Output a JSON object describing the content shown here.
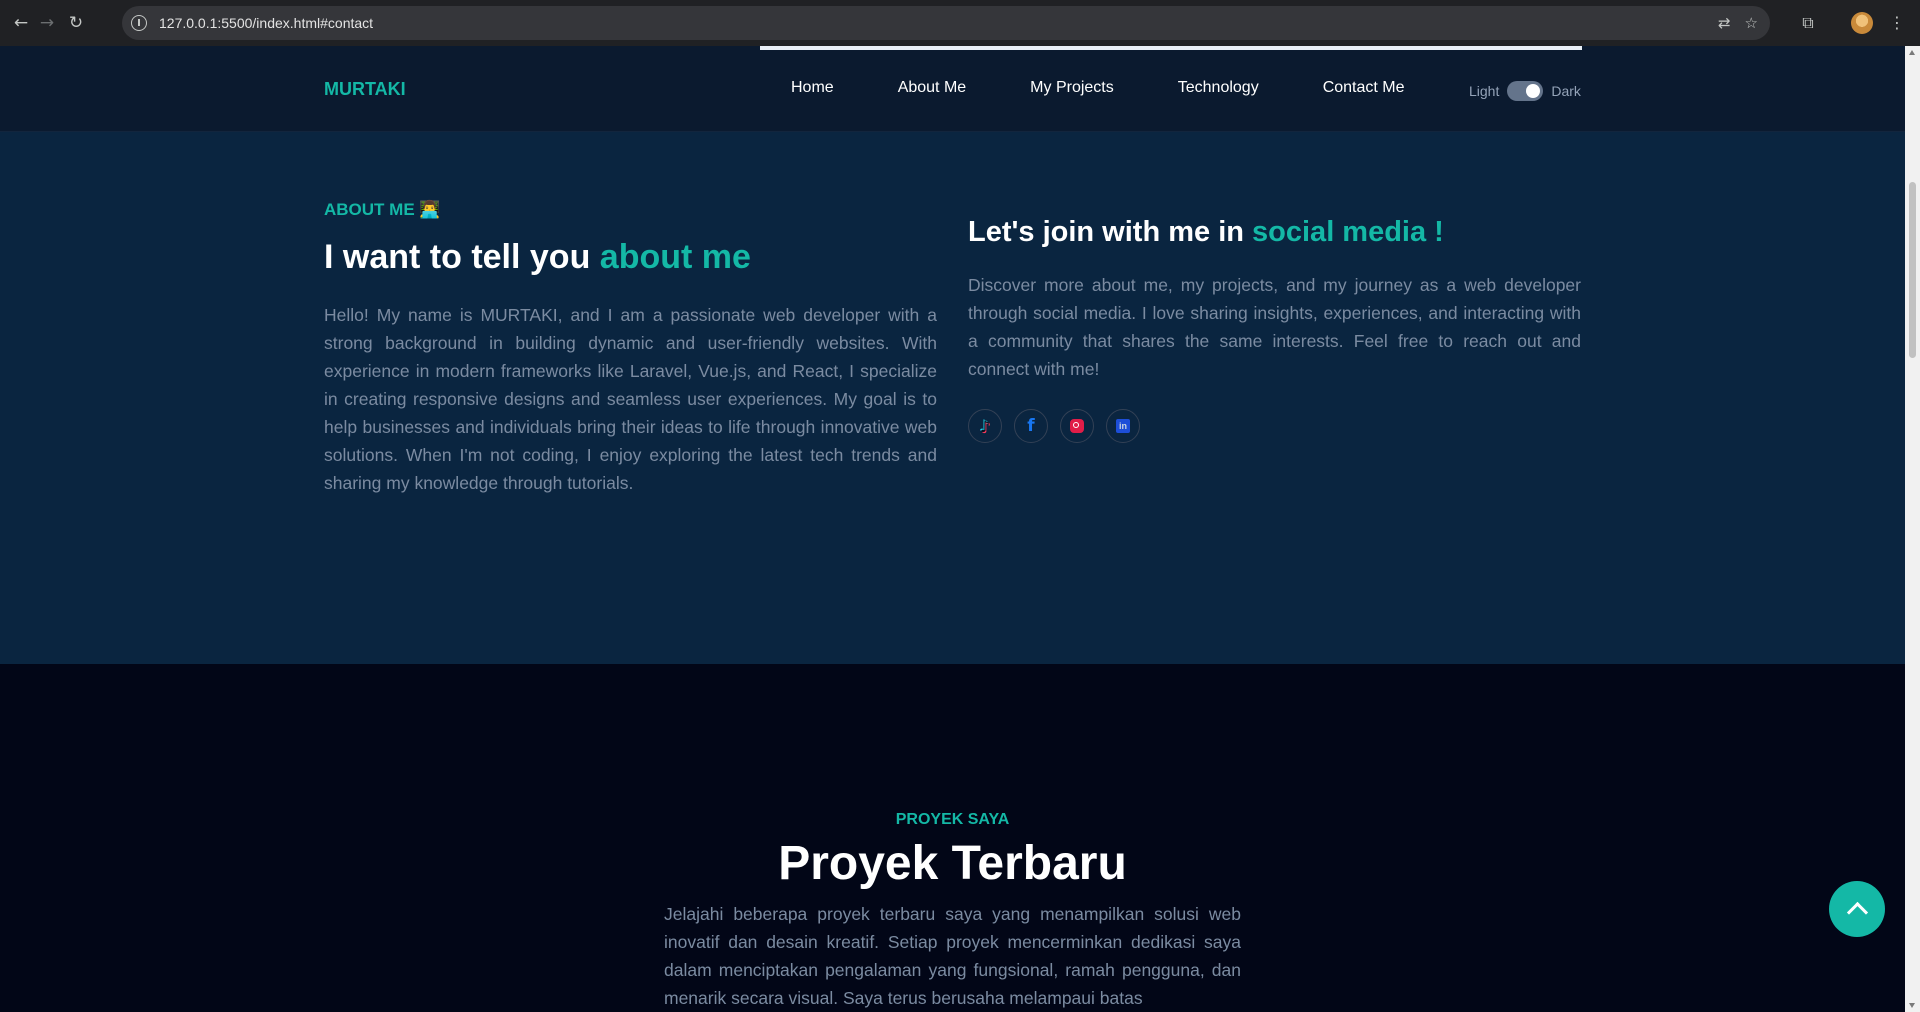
{
  "browser": {
    "url": "127.0.0.1:5500/index.html#contact",
    "icons": [
      "back-icon",
      "forward-icon",
      "reload-icon",
      "info-icon",
      "translate-icon",
      "star-icon",
      "extensions-icon",
      "profile-avatar",
      "menu-icon"
    ]
  },
  "header": {
    "logo": "MURTAKI",
    "nav": [
      "Home",
      "About Me",
      "My Projects",
      "Technology",
      "Contact Me"
    ],
    "toggle": {
      "light": "Light",
      "dark": "Dark",
      "state": "dark"
    }
  },
  "about": {
    "eyebrow": "ABOUT ME 👨‍💻",
    "heading_plain": "I want to tell you ",
    "heading_accent": "about me",
    "paragraph": "Hello! My name is MURTAKI, and I am a passionate web developer with a strong background in building dynamic and user-friendly websites. With experience in modern frameworks like Laravel, Vue.js, and React, I specialize in creating responsive designs and seamless user experiences. My goal is to help businesses and individuals bring their ideas to life through innovative web solutions. When I'm not coding, I enjoy exploring the latest tech trends and sharing my knowledge through tutorials.",
    "social_heading_plain": "Let's join with me in ",
    "social_heading_accent": "social media !",
    "social_paragraph": "Discover more about me, my projects, and my journey as a web developer through social media. I love sharing insights, experiences, and interacting with a community that shares the same interests. Feel free to reach out and connect with me!",
    "socials": [
      "tiktok-icon",
      "facebook-icon",
      "instagram-icon",
      "linkedin-icon"
    ]
  },
  "projects": {
    "eyebrow": "PROYEK SAYA",
    "title": "Proyek Terbaru",
    "paragraph": "Jelajahi beberapa proyek terbaru saya yang menampilkan solusi web inovatif dan desain kreatif. Setiap proyek mencerminkan dedikasi saya dalam menciptakan pengalaman yang fungsional, ramah pengguna, dan menarik secara visual. Saya terus berusaha melampaui batas"
  },
  "colors": {
    "accent": "#14b8a6",
    "header_bg": "#0b1a2f",
    "about_bg": "#0a2540",
    "projects_bg": "#020617"
  }
}
